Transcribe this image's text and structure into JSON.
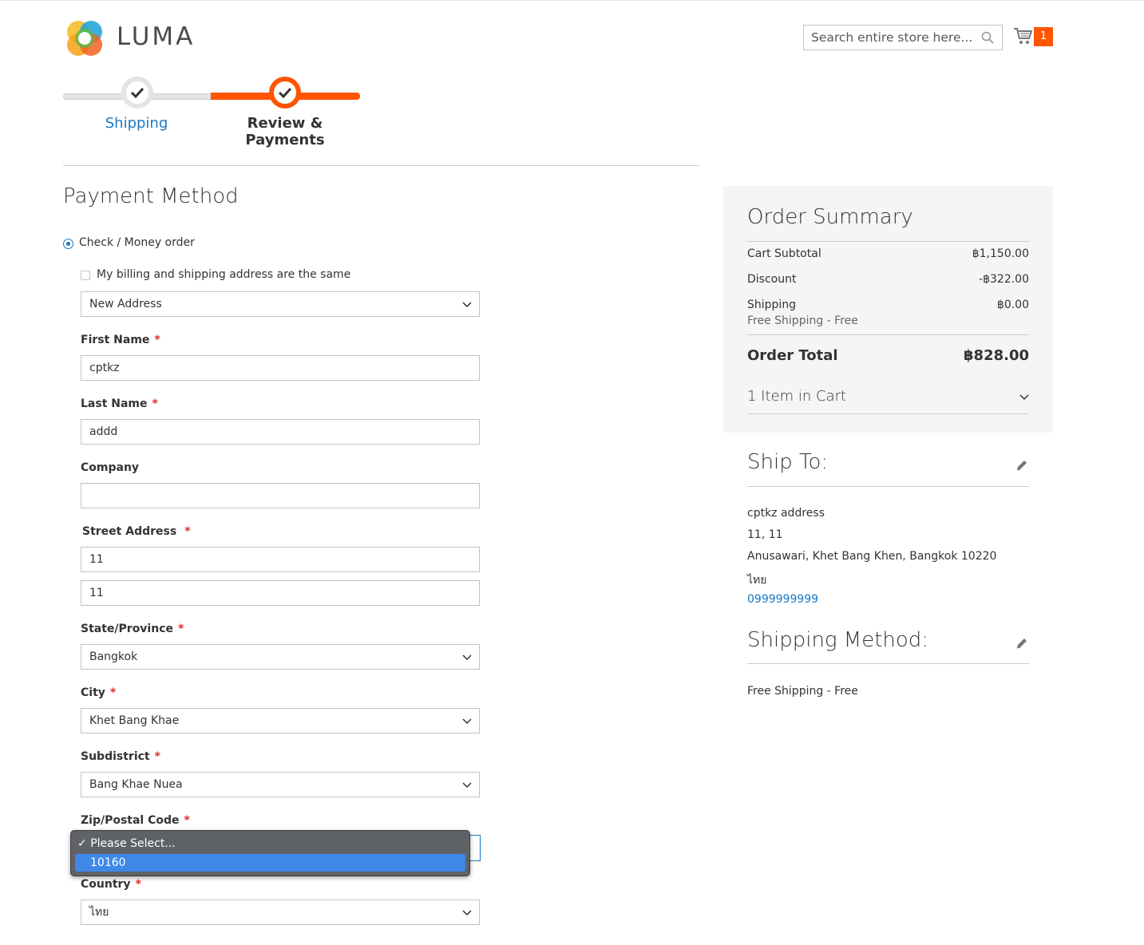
{
  "header": {
    "logo_text": "LUMA",
    "search_placeholder": "Search entire store here...",
    "cart_count": "1"
  },
  "progress": {
    "steps": [
      {
        "label": "Shipping",
        "state": "complete"
      },
      {
        "label": "Review & Payments",
        "state": "active"
      }
    ]
  },
  "payment": {
    "title": "Payment Method",
    "method_label": "Check / Money order",
    "same_address_label": "My billing and shipping address are the same",
    "address_select": "New Address",
    "fields": {
      "first_name": {
        "label": "First Name",
        "value": "cptkz"
      },
      "last_name": {
        "label": "Last Name",
        "value": "addd"
      },
      "company": {
        "label": "Company",
        "value": ""
      },
      "street": {
        "label": "Street Address",
        "line1": "11",
        "line2": "11"
      },
      "state": {
        "label": "State/Province",
        "value": "Bangkok"
      },
      "city": {
        "label": "City",
        "value": "Khet Bang Khae"
      },
      "subdistrict": {
        "label": "Subdistrict",
        "value": "Bang Khae Nuea"
      },
      "zip": {
        "label": "Zip/Postal Code",
        "options": [
          "Please Select...",
          "10160"
        ]
      },
      "country": {
        "label": "Country",
        "value": "ไทย"
      }
    },
    "required_mark": "*"
  },
  "summary": {
    "title": "Order Summary",
    "subtotal_label": "Cart Subtotal",
    "subtotal_value": "฿1,150.00",
    "discount_label": "Discount",
    "discount_value": "-฿322.00",
    "shipping_label": "Shipping",
    "shipping_value": "฿0.00",
    "shipping_method": "Free Shipping - Free",
    "total_label": "Order Total",
    "total_value": "฿828.00",
    "items_label": "1 Item in Cart"
  },
  "ship_to": {
    "title": "Ship To:",
    "lines": [
      "cptkz address",
      "11, 11",
      "Anusawari, Khet Bang Khen, Bangkok 10220",
      "ไทย"
    ],
    "phone": "0999999999"
  },
  "shipping_method": {
    "title": "Shipping Method:",
    "value": "Free Shipping - Free"
  },
  "colors": {
    "accent": "#ff5501",
    "link": "#1979c3",
    "required": "#e02b27"
  }
}
